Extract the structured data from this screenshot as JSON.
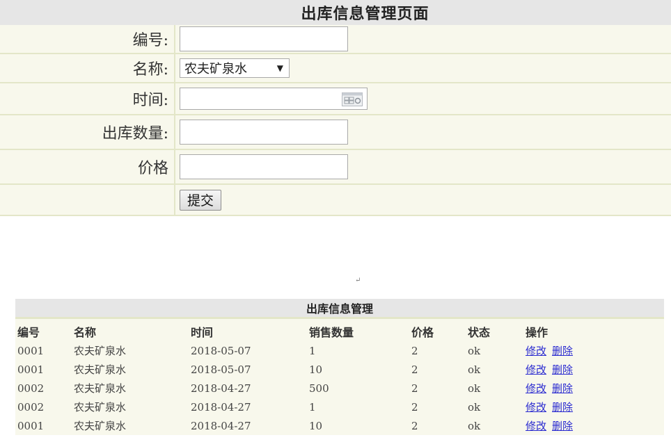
{
  "form": {
    "title": "出库信息管理页面",
    "fields": {
      "code_label": "编号:",
      "code_value": "",
      "name_label": "名称:",
      "name_selected": "农夫矿泉水",
      "time_label": "时间:",
      "time_value": "",
      "qty_label": "出库数量:",
      "qty_value": "",
      "price_label": "价格",
      "price_value": ""
    },
    "submit_label": "提交"
  },
  "return_mark": "↵",
  "table": {
    "title": "出库信息管理",
    "columns": [
      "编号",
      "名称",
      "时间",
      "销售数量",
      "价格",
      "状态",
      "操作"
    ],
    "rows": [
      {
        "code": "0001",
        "name": "农夫矿泉水",
        "time": "2018-05-07",
        "qty": "1",
        "price": "2",
        "status": "ok",
        "edit": "修改",
        "delete": "删除"
      },
      {
        "code": "0001",
        "name": "农夫矿泉水",
        "time": "2018-05-07",
        "qty": "10",
        "price": "2",
        "status": "ok",
        "edit": "修改",
        "delete": "删除"
      },
      {
        "code": "0002",
        "name": "农夫矿泉水",
        "time": "2018-04-27",
        "qty": "500",
        "price": "2",
        "status": "ok",
        "edit": "修改",
        "delete": "删除"
      },
      {
        "code": "0002",
        "name": "农夫矿泉水",
        "time": "2018-04-27",
        "qty": "1",
        "price": "2",
        "status": "ok",
        "edit": "修改",
        "delete": "删除"
      },
      {
        "code": "0001",
        "name": "农夫矿泉水",
        "time": "2018-04-27",
        "qty": "10",
        "price": "2",
        "status": "ok",
        "edit": "修改",
        "delete": "删除"
      }
    ]
  },
  "icons": {
    "calendar": "calendar-icon",
    "dropdown": "chevron-down-icon"
  },
  "colors": {
    "panel_bg": "#f8f8ec",
    "title_bar_bg": "#e6e6e6",
    "border": "#e3e6c8",
    "link": "#2a2ad0"
  }
}
